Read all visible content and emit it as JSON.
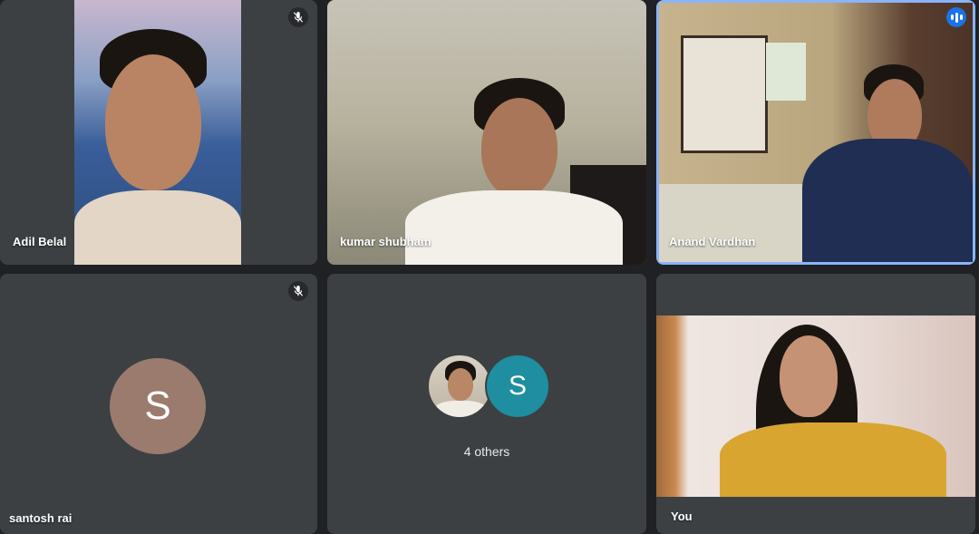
{
  "participants": [
    {
      "name": "Adil Belal",
      "muted": true
    },
    {
      "name": "kumar shubham",
      "muted": false
    },
    {
      "name": "Anand Vardhan",
      "speaking": true
    },
    {
      "name": "santosh rai",
      "muted": true,
      "initial": "S"
    },
    {
      "others_label": "4 others",
      "initial": "S"
    },
    {
      "name": "You"
    }
  ],
  "icons": {
    "mute": "mic-off-icon",
    "speaking": "audio-level-icon"
  },
  "colors": {
    "background": "#202124",
    "tile": "#3c4043",
    "active_border": "#8ab4f8",
    "speaking": "#1a73e8",
    "avatar_santosh": "#9a7b6e",
    "avatar_s_group": "#1e8ea0"
  }
}
